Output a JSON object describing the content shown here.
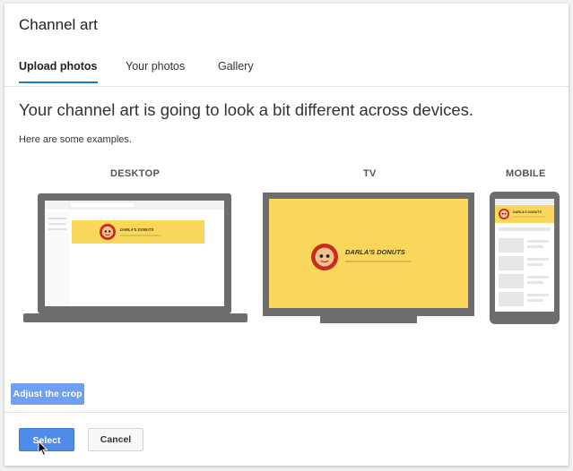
{
  "dialog": {
    "title": "Channel art",
    "tabs": [
      {
        "label": "Upload photos",
        "active": true
      },
      {
        "label": "Your photos",
        "active": false
      },
      {
        "label": "Gallery",
        "active": false
      }
    ],
    "headline": "Your channel art is going to look a bit different across devices.",
    "subtext": "Here are some examples.",
    "devices": {
      "desktop_label": "DESKTOP",
      "tv_label": "TV",
      "mobile_label": "MOBILE"
    },
    "banner": {
      "brand_text": "DARLA'S DONUTS",
      "background_color": "#f9d65c"
    },
    "buttons": {
      "adjust_crop": "Adjust the crop",
      "select": "Select",
      "cancel": "Cancel"
    }
  },
  "colors": {
    "accent": "#167ac6",
    "primary_button": "#4f8ce8",
    "device_frame": "#6d6d6d"
  },
  "icons": {
    "cursor": "mouse-pointer-icon"
  }
}
